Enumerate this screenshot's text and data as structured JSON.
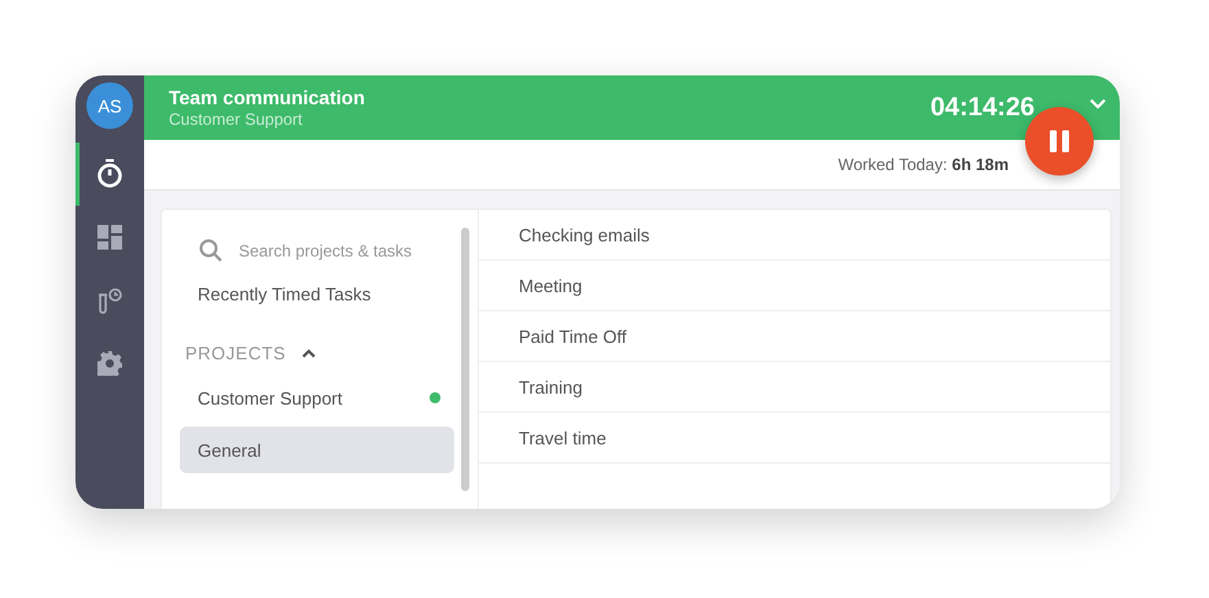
{
  "user": {
    "initials": "AS"
  },
  "nav": [
    {
      "kind": "timer",
      "selected": true
    },
    {
      "kind": "dashboard",
      "selected": false
    },
    {
      "kind": "reports",
      "selected": false
    },
    {
      "kind": "settings",
      "selected": false
    }
  ],
  "header": {
    "task": "Team communication",
    "project": "Customer Support",
    "timer": "04:14:26",
    "running": true
  },
  "worked_today": {
    "label": "Worked Today:",
    "value": "6h 18m"
  },
  "search": {
    "placeholder": "Search projects & tasks"
  },
  "recent": "Recently Timed Tasks",
  "projects": {
    "heading": "PROJECTS",
    "expanded": true,
    "items": [
      {
        "name": "Customer Support",
        "selected": false,
        "timing": true
      },
      {
        "name": "General",
        "selected": true,
        "timing": false
      }
    ]
  },
  "tasks": [
    "Checking emails",
    "Meeting",
    "Paid Time Off",
    "Training",
    "Travel time"
  ]
}
